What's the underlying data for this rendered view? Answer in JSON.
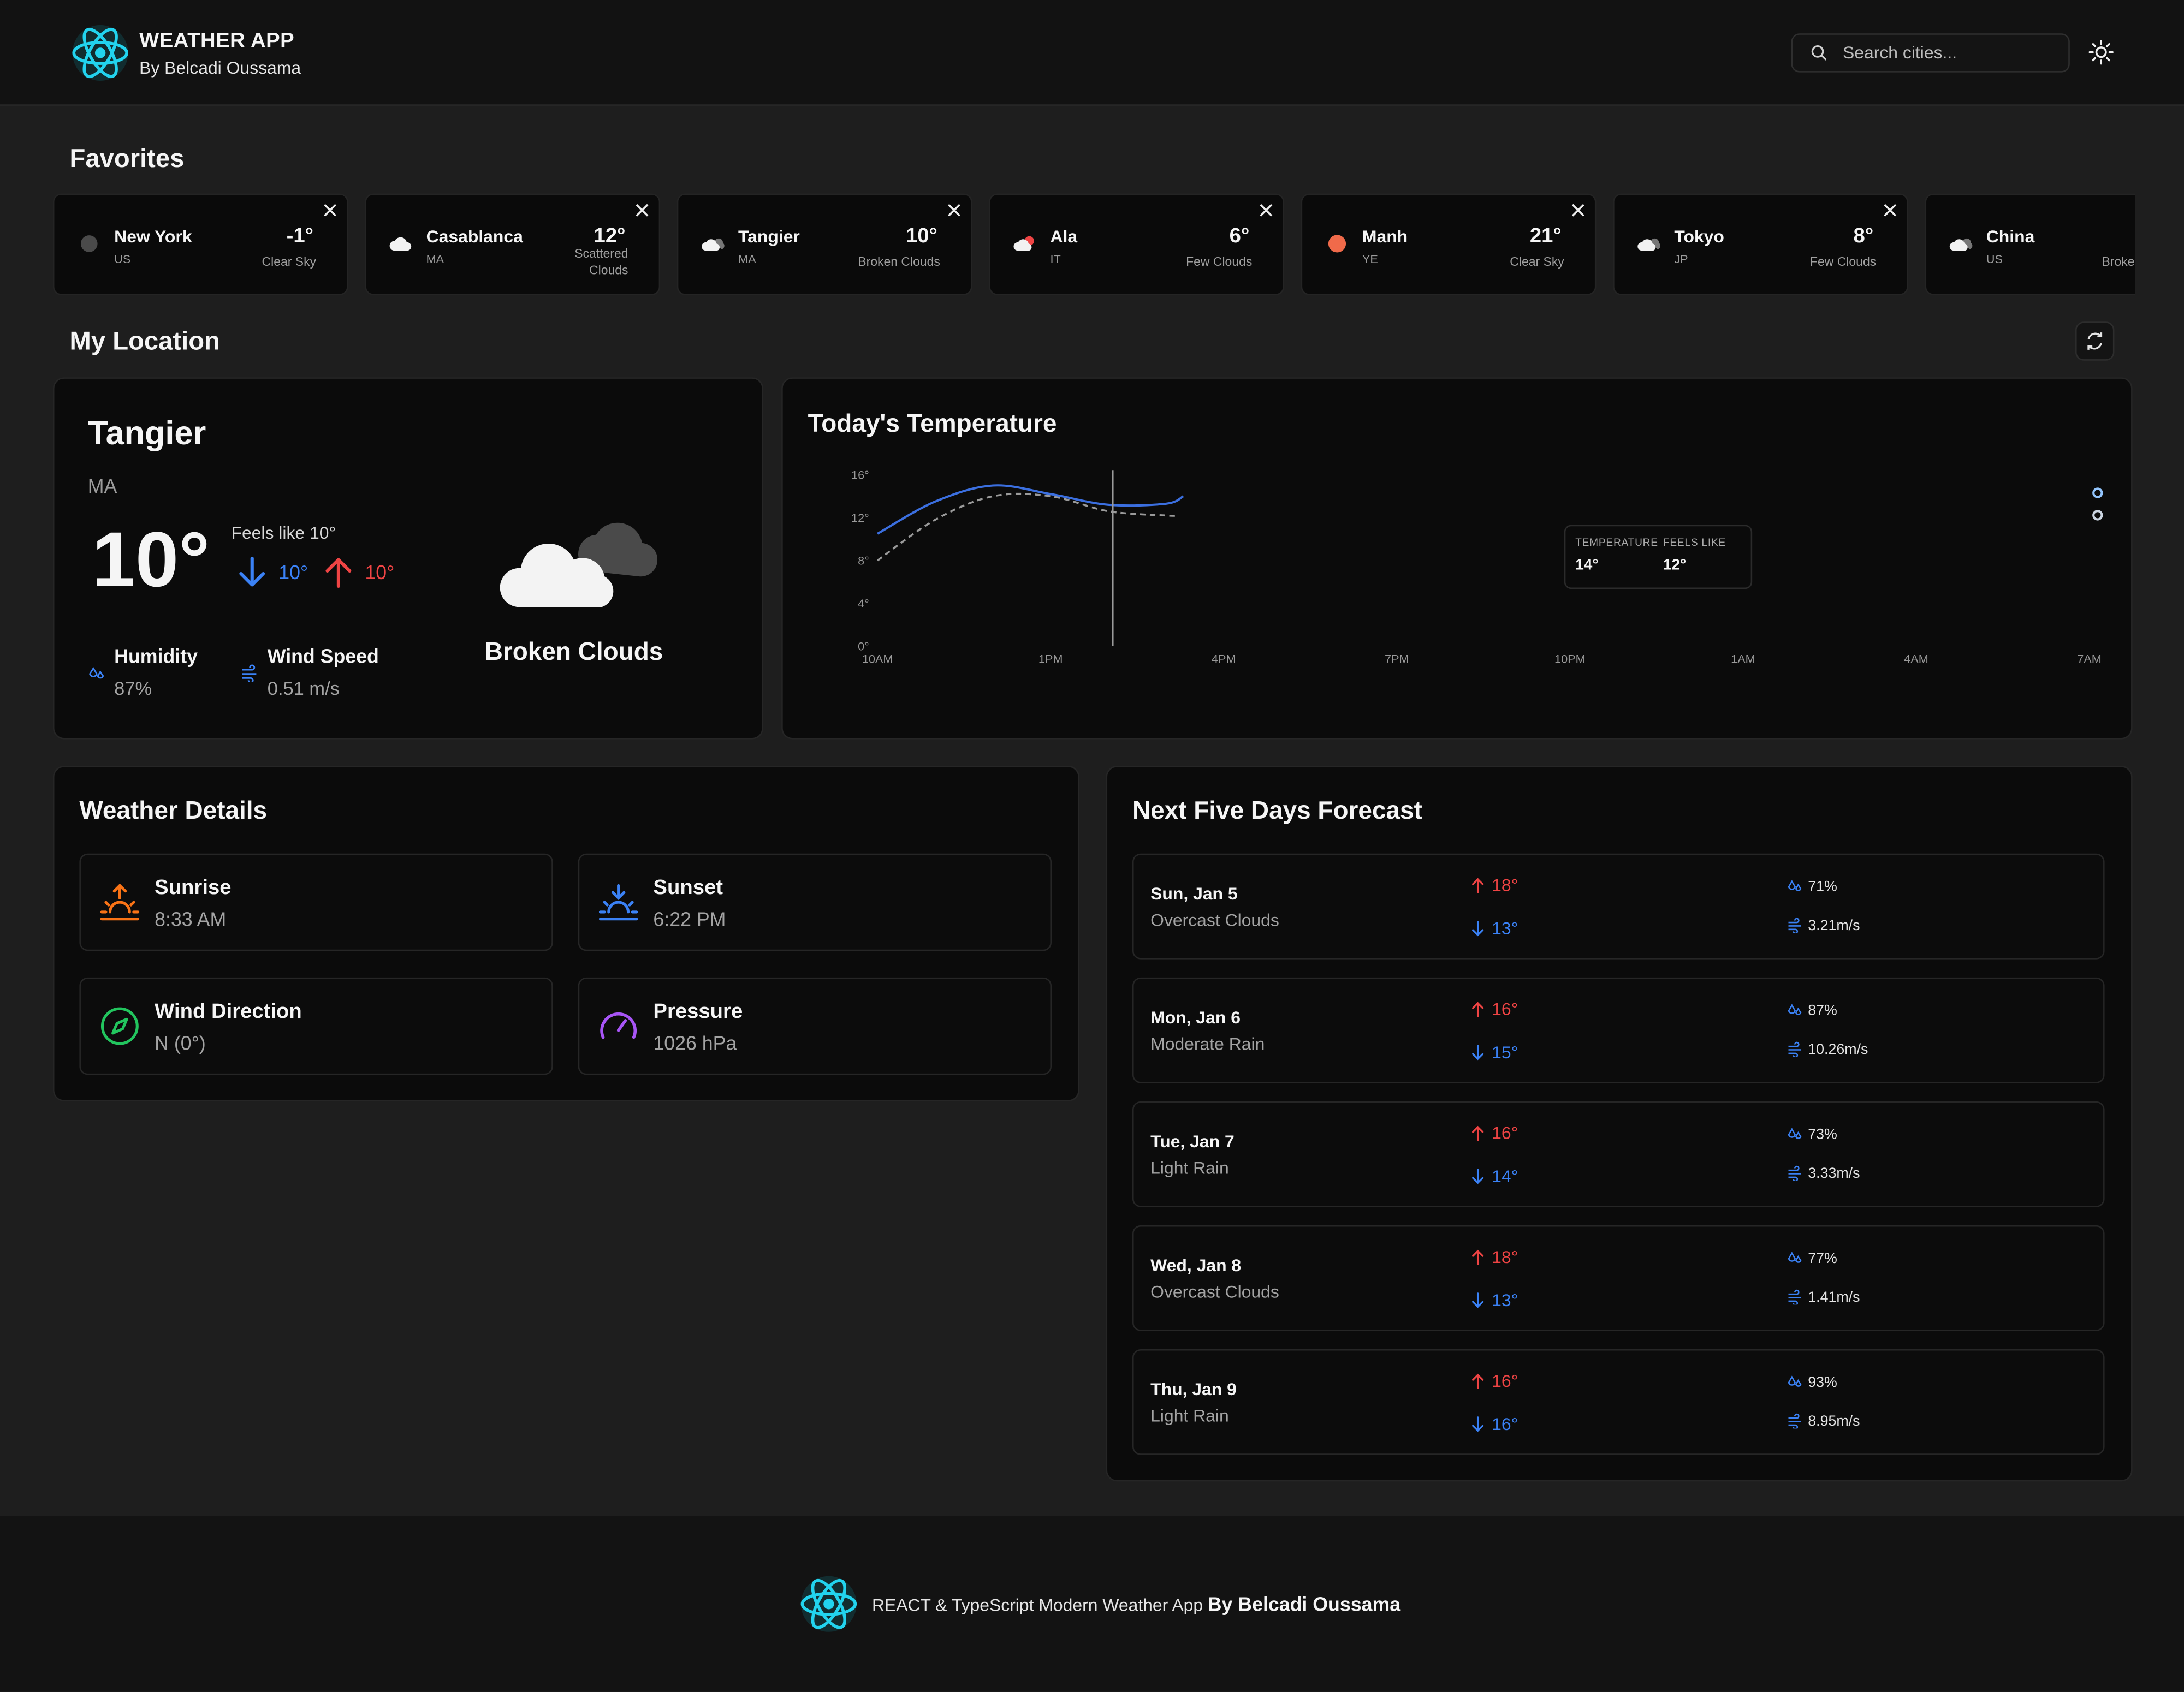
{
  "header": {
    "title": "WEATHER APP",
    "subtitle": "By Belcadi Oussama",
    "search_placeholder": "Search cities...",
    "logo_icon": "react-atom-icon",
    "theme_icon": "sun-icon"
  },
  "favorites": {
    "title": "Favorites",
    "items": [
      {
        "city": "New York",
        "country": "US",
        "temp": "-1°",
        "condition": "Clear Sky",
        "icon": "clear-night-icon"
      },
      {
        "city": "Casablanca",
        "country": "MA",
        "temp": "12°",
        "condition": "Scattered Clouds",
        "icon": "cloud-icon"
      },
      {
        "city": "Tangier",
        "country": "MA",
        "temp": "10°",
        "condition": "Broken Clouds",
        "icon": "broken-clouds-icon"
      },
      {
        "city": "Ala",
        "country": "IT",
        "temp": "6°",
        "condition": "Few Clouds",
        "icon": "few-clouds-icon"
      },
      {
        "city": "Manh",
        "country": "YE",
        "temp": "21°",
        "condition": "Clear Sky",
        "icon": "sun-icon"
      },
      {
        "city": "Tokyo",
        "country": "JP",
        "temp": "8°",
        "condition": "Few Clouds",
        "icon": "broken-clouds-icon"
      },
      {
        "city": "China",
        "country": "US",
        "temp": "",
        "condition": "Broke",
        "icon": "broken-clouds-icon"
      }
    ]
  },
  "location": {
    "title": "My Location",
    "city": "Tangier",
    "country": "MA",
    "temp": "10°",
    "feels_like": "Feels like 10°",
    "min": "10°",
    "max": "10°",
    "humidity_label": "Humidity",
    "humidity": "87%",
    "wind_label": "Wind Speed",
    "wind": "0.51 m/s",
    "condition": "Broken Clouds"
  },
  "chart_data": {
    "type": "line",
    "title": "Today's Temperature",
    "x": [
      "10AM",
      "1PM",
      "4PM",
      "7PM",
      "10PM",
      "1AM",
      "4AM",
      "7AM"
    ],
    "y_ticks": [
      "16°",
      "12°",
      "8°",
      "4°",
      "0°"
    ],
    "ylim": [
      0,
      16
    ],
    "series": [
      {
        "name": "TEMPERATURE",
        "color": "#3b6fe0",
        "points": [
          [
            10.0,
            10.5
          ],
          [
            11.0,
            13.5
          ],
          [
            12.0,
            15.0
          ],
          [
            13.0,
            14.2
          ],
          [
            14.0,
            13.2
          ],
          [
            15.0,
            13.3
          ],
          [
            15.3,
            14.0
          ]
        ]
      },
      {
        "name": "FEELS LIKE",
        "color": "#9a9a9a",
        "dashed": true,
        "points": [
          [
            10.0,
            8.0
          ],
          [
            11.0,
            11.8
          ],
          [
            12.0,
            14.0
          ],
          [
            13.0,
            14.0
          ],
          [
            14.0,
            12.6
          ],
          [
            15.0,
            12.2
          ],
          [
            15.2,
            12.2
          ]
        ]
      }
    ],
    "tooltip": {
      "temp_label": "TEMPERATURE",
      "temp": "14°",
      "feels_label": "FEELS LIKE",
      "feels": "12°"
    }
  },
  "details": {
    "title": "Weather Details",
    "items": [
      {
        "label": "Sunrise",
        "value": "8:33 AM",
        "icon": "sunrise-icon",
        "color": "#f97316"
      },
      {
        "label": "Sunset",
        "value": "6:22 PM",
        "icon": "sunset-icon",
        "color": "#3b82f6"
      },
      {
        "label": "Wind Direction",
        "value": "N (0°)",
        "icon": "compass-icon",
        "color": "#22c55e"
      },
      {
        "label": "Pressure",
        "value": "1026 hPa",
        "icon": "gauge-icon",
        "color": "#a855f7"
      }
    ]
  },
  "forecast": {
    "title": "Next Five Days Forecast",
    "days": [
      {
        "date": "Sun, Jan 5",
        "desc": "Overcast Clouds",
        "max": "18°",
        "min": "13°",
        "humidity": "71%",
        "wind": "3.21m/s"
      },
      {
        "date": "Mon, Jan 6",
        "desc": "Moderate Rain",
        "max": "16°",
        "min": "15°",
        "humidity": "87%",
        "wind": "10.26m/s"
      },
      {
        "date": "Tue, Jan 7",
        "desc": "Light Rain",
        "max": "16°",
        "min": "14°",
        "humidity": "73%",
        "wind": "3.33m/s"
      },
      {
        "date": "Wed, Jan 8",
        "desc": "Overcast Clouds",
        "max": "18°",
        "min": "13°",
        "humidity": "77%",
        "wind": "1.41m/s"
      },
      {
        "date": "Thu, Jan 9",
        "desc": "Light Rain",
        "max": "16°",
        "min": "16°",
        "humidity": "93%",
        "wind": "8.95m/s"
      }
    ]
  },
  "footer": {
    "text": "REACT & TypeScript Modern Weather App",
    "author": "By Belcadi Oussama"
  },
  "colors": {
    "accent_cyan": "#22d3ee",
    "hot": "#ef4444",
    "cold": "#3b82f6"
  }
}
